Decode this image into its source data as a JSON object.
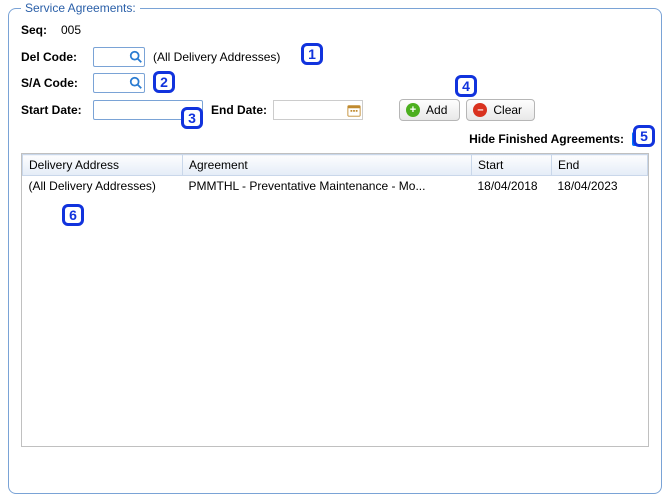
{
  "panel": {
    "title": "Service Agreements:"
  },
  "form": {
    "seq_label": "Seq:",
    "seq_value": "005",
    "del_code_label": "Del Code:",
    "del_code_value": "",
    "del_code_hint": "(All Delivery Addresses)",
    "sa_code_label": "S/A Code:",
    "sa_code_value": "",
    "start_date_label": "Start Date:",
    "start_date_value": "",
    "end_date_label": "End Date:",
    "end_date_value": ""
  },
  "buttons": {
    "add_label": "Add",
    "clear_label": "Clear"
  },
  "hide_finished": {
    "label": "Hide Finished Agreements:",
    "checked": true
  },
  "table": {
    "headers": {
      "delivery": "Delivery Address",
      "agreement": "Agreement",
      "start": "Start",
      "end": "End"
    },
    "rows": [
      {
        "delivery": "(All Delivery Addresses)",
        "agreement": "PMMTHL - Preventative Maintenance - Mo...",
        "start": "18/04/2018",
        "end": "18/04/2023"
      }
    ]
  },
  "annotations": {
    "a1": "1",
    "a2": "2",
    "a3": "3",
    "a4": "4",
    "a5": "5",
    "a6": "6"
  }
}
